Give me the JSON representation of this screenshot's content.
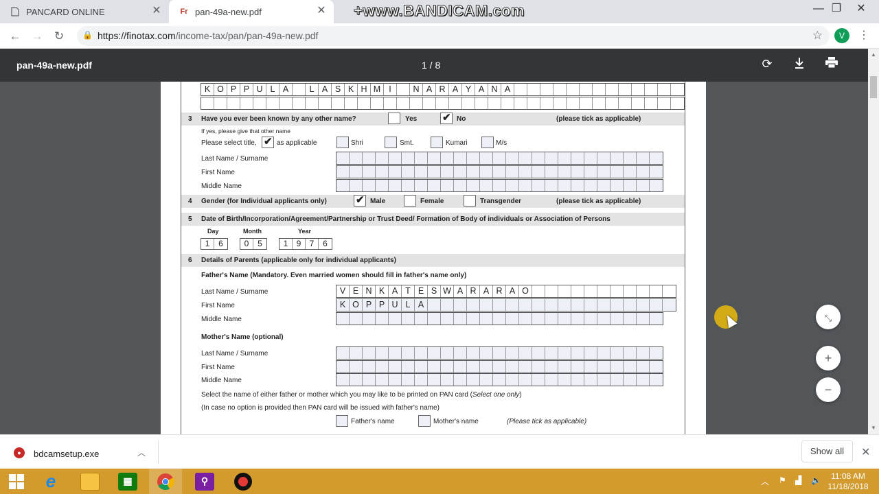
{
  "browser": {
    "tabs": [
      {
        "title": "PANCARD ONLINE",
        "icon": "document-icon"
      },
      {
        "title": "pan-49a-new.pdf",
        "icon": "finotax-icon",
        "favicon_text": "Fr"
      }
    ],
    "watermark": "+www.BANDICAM.com",
    "url_host": "https://finotax.com",
    "url_path": "/income-tax/pan/pan-49a-new.pdf",
    "profile_initial": "V"
  },
  "pdf_toolbar": {
    "filename": "pan-49a-new.pdf",
    "page_indicator": "1 / 8"
  },
  "form": {
    "name_row1": [
      "K",
      "O",
      "P",
      "P",
      "U",
      "L",
      "A",
      "",
      "L",
      "A",
      "S",
      "K",
      "H",
      "M",
      "I",
      "",
      "N",
      "A",
      "R",
      "A",
      "Y",
      "A",
      "N",
      "A",
      "",
      "",
      "",
      "",
      "",
      "",
      "",
      "",
      "",
      "",
      "",
      "",
      ""
    ],
    "q3": {
      "num": "3",
      "question": "Have you ever been known by any other name?",
      "yes": "Yes",
      "no": "No",
      "answer": "No",
      "hint": "(please tick as applicable)",
      "note": "If yes, please give that other name",
      "title_prompt": "Please select title,",
      "title_suffix": "as applicable",
      "titles": [
        "Shri",
        "Smt.",
        "Kumari",
        "M/s"
      ],
      "last": "Last Name / Surname",
      "first": "First Name",
      "middle": "Middle Name"
    },
    "q4": {
      "num": "4",
      "question": "Gender (for Individual applicants only)",
      "options": [
        "Male",
        "Female",
        "Transgender"
      ],
      "answer": "Male",
      "hint": "(please tick as applicable)"
    },
    "q5": {
      "num": "5",
      "question": "Date of Birth/Incorporation/Agreement/Partnership or Trust Deed/ Formation of Body of individuals or Association of Persons",
      "day_label": "Day",
      "month_label": "Month",
      "year_label": "Year",
      "day": [
        "1",
        "6"
      ],
      "month": [
        "0",
        "5"
      ],
      "year": [
        "1",
        "9",
        "7",
        "6"
      ]
    },
    "q6": {
      "num": "6",
      "question": "Details of Parents (applicable only for individual applicants)",
      "father_heading": "Father's Name (Mandatory. Even married women should fill in father's name only)",
      "last": "Last Name / Surname",
      "first": "First Name",
      "middle": "Middle Name",
      "father_last": [
        "V",
        "E",
        "N",
        "K",
        "A",
        "T",
        "E",
        "S",
        "W",
        "A",
        "R",
        "A",
        "R",
        "A",
        "O",
        "",
        "",
        "",
        "",
        "",
        "",
        "",
        "",
        "",
        "",
        ""
      ],
      "father_first": [
        "K",
        "O",
        "P",
        "P",
        "U",
        "L",
        "A",
        "",
        "",
        "",
        "",
        "",
        "",
        "",
        "",
        "",
        "",
        "",
        "",
        "",
        "",
        "",
        "",
        "",
        "",
        ""
      ],
      "mother_heading": "Mother's Name (optional)",
      "select_text": "Select the name of either father or mother which you may like to be printed on PAN card (",
      "select_italic": "Select one only",
      "select_close": ")",
      "default_text": "(In case no option is provided then PAN card will be issued with father's name)",
      "father_option": "Father's name",
      "mother_option": "Mother's name",
      "hint": "(Please tick as applicable)"
    }
  },
  "downloads": {
    "file": "bdcamsetup.exe",
    "show_all": "Show all"
  },
  "taskbar": {
    "time": "11:08 AM",
    "date": "11/18/2018"
  }
}
